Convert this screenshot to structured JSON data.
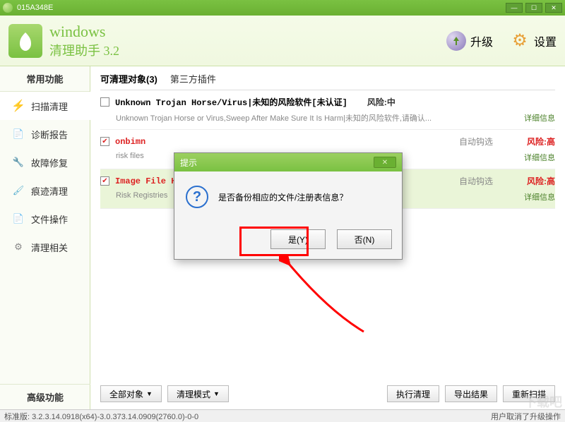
{
  "window": {
    "title": "015A348E"
  },
  "app": {
    "name_line1": "windows",
    "name_line2": "清理助手 3.2"
  },
  "header_actions": {
    "upgrade": "升级",
    "settings": "设置"
  },
  "sidebar": {
    "common_title": "常用功能",
    "items": [
      {
        "label": "扫描清理"
      },
      {
        "label": "诊断报告"
      },
      {
        "label": "故障修复"
      },
      {
        "label": "痕迹清理"
      },
      {
        "label": "文件操作"
      },
      {
        "label": "清理相关"
      }
    ],
    "advanced_title": "高级功能"
  },
  "tabs": {
    "cleanable": "可清理对象(3)",
    "plugins": "第三方插件"
  },
  "results": [
    {
      "checked": false,
      "name": "Unknown Trojan Horse/Virus|未知的风险软件[未认证]",
      "name_red": false,
      "auto": "",
      "risk": "风险:中",
      "risk_class": "med",
      "sub": "Unknown Trojan Horse or Virus,Sweep After Make Sure It Is Harm|未知的风险软件,请确认...",
      "detail": "详细信息"
    },
    {
      "checked": true,
      "name": "onbimn",
      "name_red": true,
      "auto": "自动钩选",
      "risk": "风险:高",
      "risk_class": "",
      "sub": "risk files",
      "detail": "详细信息"
    },
    {
      "checked": true,
      "name": "Image File Hi",
      "name_red": true,
      "auto": "自动钩选",
      "risk": "风险:高",
      "risk_class": "",
      "sub": "Risk Registries",
      "detail": "详细信息",
      "selected": true
    }
  ],
  "bottom": {
    "all": "全部对象",
    "mode": "清理模式",
    "exec": "执行清理",
    "export": "导出结果",
    "rescan": "重新扫描"
  },
  "dialog": {
    "title": "提示",
    "message": "是否备份相应的文件/注册表信息？",
    "yes": "是(Y)",
    "no": "否(N)"
  },
  "status": {
    "version": "标准版: 3.2.3.14.0918(x64)-3.0.373.14.0909(2760.0)-0-0",
    "right": "用户取消了升级操作"
  },
  "watermark": "下载吧"
}
